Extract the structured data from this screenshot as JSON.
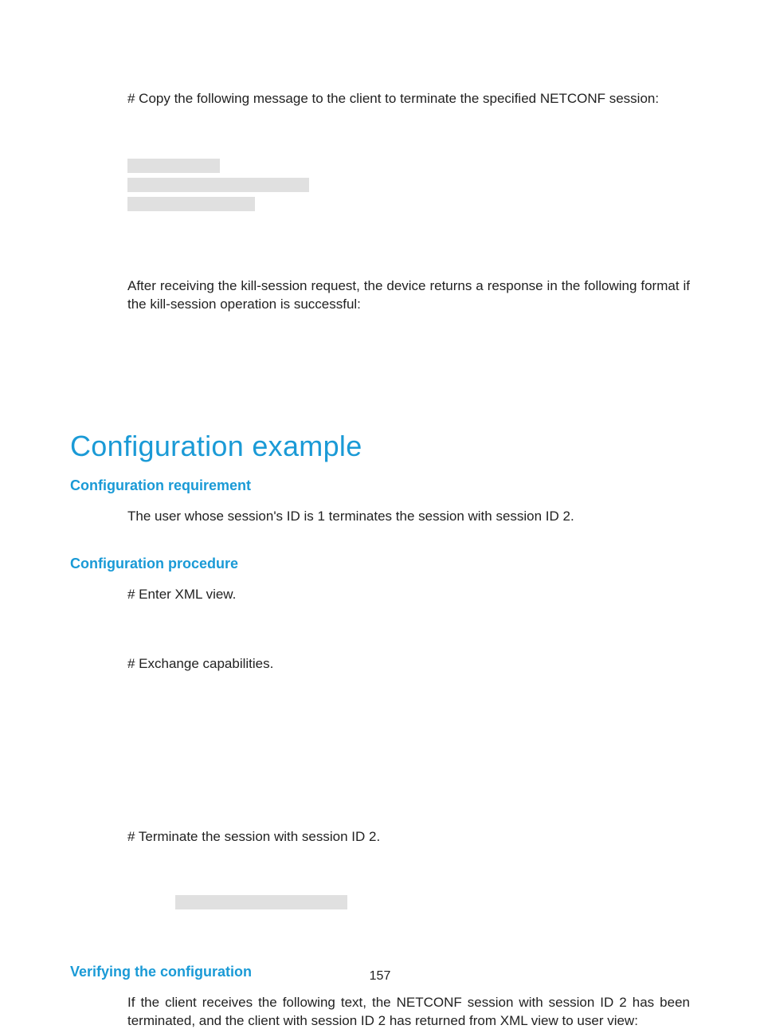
{
  "intro_line": "# Copy the following message to the client to terminate the specified NETCONF session:",
  "after_kill": "After receiving the kill-session request, the device returns a response in the following format if the kill-session operation is successful:",
  "h1": "Configuration example",
  "sec_req": {
    "title": "Configuration requirement",
    "text": "The user whose session's ID is 1 terminates the session with session ID 2."
  },
  "sec_proc": {
    "title": "Configuration procedure",
    "step1": "# Enter XML view.",
    "step2": "# Exchange capabilities.",
    "step3": "# Terminate the session with session ID 2."
  },
  "sec_verify": {
    "title": "Verifying the configuration",
    "text": "If the client receives the following text, the NETCONF session with session ID 2 has been terminated, and the client with session ID 2 has returned from XML view to user view:"
  },
  "page_number": "157"
}
